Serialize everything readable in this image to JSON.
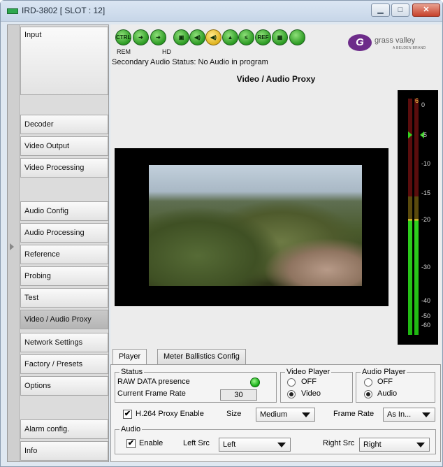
{
  "window": {
    "title": "IRD-3802 [ SLOT : 12]",
    "min_glyph": "▁",
    "max_glyph": "□",
    "close_glyph": "✕"
  },
  "sidebar": {
    "items": [
      {
        "label": "Input"
      },
      {
        "label": "Decoder"
      },
      {
        "label": "Video Output"
      },
      {
        "label": "Video Processing"
      },
      {
        "label": "Audio Config"
      },
      {
        "label": "Audio Processing"
      },
      {
        "label": "Reference"
      },
      {
        "label": "Probing"
      },
      {
        "label": "Test"
      },
      {
        "label": "Video / Audio Proxy",
        "active": true
      },
      {
        "label": "Network Settings"
      },
      {
        "label": "Factory / Presets"
      },
      {
        "label": "Options"
      },
      {
        "label": "Alarm config."
      },
      {
        "label": "Info"
      }
    ]
  },
  "toolbar": {
    "icons": [
      {
        "name": "ctrl-icon",
        "glyph": "CTRL",
        "color": "green"
      },
      {
        "name": "arrow-right-icon",
        "glyph": "➜",
        "color": "green"
      },
      {
        "name": "arrow-right-icon-2",
        "glyph": "➜",
        "color": "green"
      },
      {
        "name": "lock-icon",
        "glyph": "▣",
        "color": "green"
      },
      {
        "name": "speaker-icon",
        "glyph": "◀)",
        "color": "green"
      },
      {
        "name": "speaker-warning-icon",
        "glyph": "◀)",
        "color": "yellow"
      },
      {
        "name": "audio-lock-icon",
        "glyph": "▲",
        "color": "green"
      },
      {
        "name": "less-than-icon",
        "glyph": "≤",
        "color": "green"
      },
      {
        "name": "ref-icon",
        "glyph": "REF",
        "color": "green"
      },
      {
        "name": "color-bars-icon",
        "glyph": "▦",
        "color": "green"
      },
      {
        "name": "status-led-icon",
        "glyph": "",
        "color": "green"
      }
    ],
    "captions": {
      "rem": "REM",
      "hd": "HD"
    },
    "logo": {
      "mark": "G",
      "word": "grass valley",
      "sub": "A BELDEN BRAND"
    }
  },
  "status_line": "Secondary Audio Status: No Audio in program",
  "panel_title": "Video / Audio Proxy",
  "meter": {
    "peak_label": "6",
    "scale": [
      "0",
      "-5",
      "-10",
      "-15",
      "-20",
      "-30",
      "-40",
      "-50",
      "-60"
    ],
    "left_level": 0.49,
    "right_level": 0.49
  },
  "tabs": [
    {
      "label": "Player",
      "active": true
    },
    {
      "label": "Meter Ballistics Config",
      "active": false
    }
  ],
  "status_group": {
    "legend": "Status",
    "raw_data_label": "RAW DATA presence",
    "frame_rate_label": "Current Frame Rate",
    "frame_rate_value": "30"
  },
  "video_player": {
    "legend": "Video Player",
    "options": [
      "OFF",
      "Video"
    ],
    "selected": "Video"
  },
  "audio_player": {
    "legend": "Audio Player",
    "options": [
      "OFF",
      "Audio"
    ],
    "selected": "Audio"
  },
  "proxy": {
    "enable_label": "H.264 Proxy Enable",
    "enabled": true,
    "size_label": "Size",
    "size_value": "Medium",
    "frame_rate_label": "Frame Rate",
    "frame_rate_value": "As In..."
  },
  "audio_group": {
    "legend": "Audio",
    "enable_label": "Enable",
    "enabled": true,
    "left_src_label": "Left Src",
    "left_src_value": "Left",
    "right_src_label": "Right Src",
    "right_src_value": "Right"
  },
  "check_glyph": "✔"
}
